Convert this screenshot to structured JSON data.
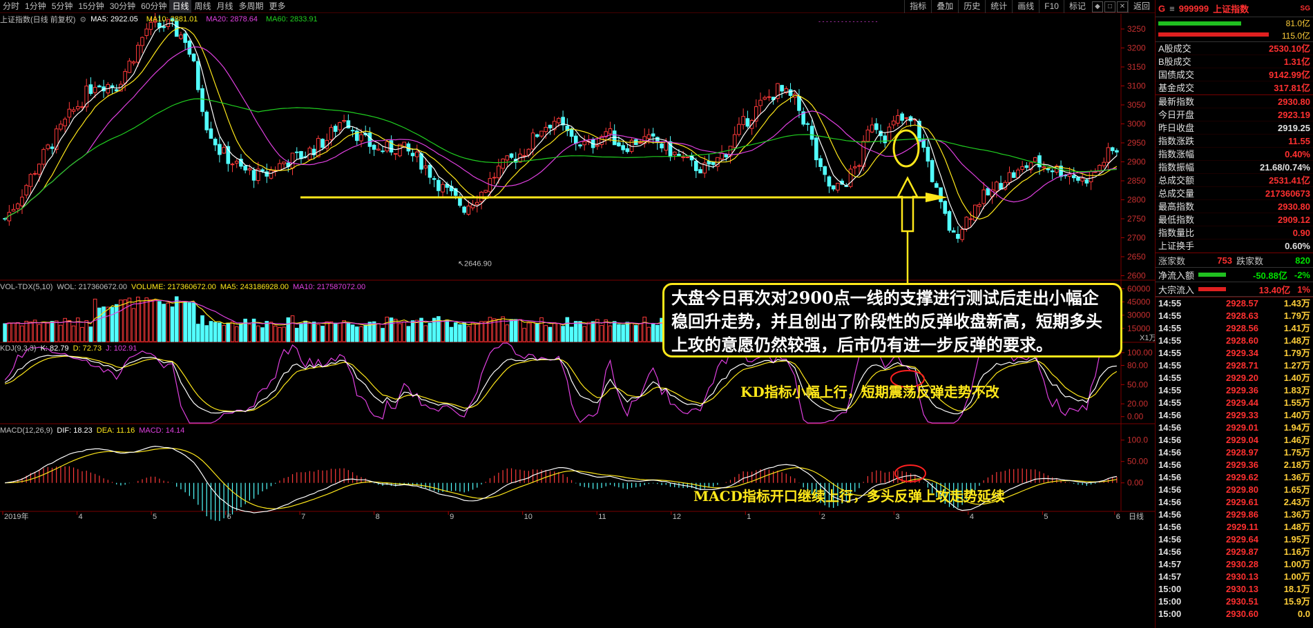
{
  "timeframes": [
    "分时",
    "1分钟",
    "5分钟",
    "15分钟",
    "30分钟",
    "60分钟",
    "日线",
    "周线",
    "月线",
    "多周期",
    "更多"
  ],
  "active_tf": "日线",
  "tools": [
    "指标",
    "叠加",
    "历史",
    "统计",
    "画线",
    "F10",
    "标记"
  ],
  "win_btns": [
    "◆",
    "□",
    "✕",
    "返回"
  ],
  "main_title": "上证指数(日线 前复权)",
  "ma_labels": [
    {
      "t": "MA5: 2922.05",
      "c": "#ffffff"
    },
    {
      "t": "MA10: 2881.01",
      "c": "#ffe81a"
    },
    {
      "t": "MA20: 2878.64",
      "c": "#e040e0"
    },
    {
      "t": "MA60: 2833.91",
      "c": "#20d020"
    }
  ],
  "vol_labels": [
    {
      "t": "VOL-TDX(5,10)",
      "c": "#c0c0c0"
    },
    {
      "t": "WOL: 217360672.00",
      "c": "#c0c0c0"
    },
    {
      "t": "VOLUME: 217360672.00",
      "c": "#ffe81a"
    },
    {
      "t": "MA5: 243186928.00",
      "c": "#ffe81a"
    },
    {
      "t": "MA10: 217587072.00",
      "c": "#e040e0"
    }
  ],
  "kdj_labels": [
    {
      "t": "KDJ(9,3,3)",
      "c": "#c0c0c0"
    },
    {
      "t": "K: 82.79",
      "c": "#ffffff"
    },
    {
      "t": "D: 72.73",
      "c": "#ffe81a"
    },
    {
      "t": "J: 102.91",
      "c": "#e040e0"
    }
  ],
  "macd_labels": [
    {
      "t": "MACD(12,26,9)",
      "c": "#c0c0c0"
    },
    {
      "t": "DIF: 18.23",
      "c": "#ffffff"
    },
    {
      "t": "DEA: 11.16",
      "c": "#ffe81a"
    },
    {
      "t": "MACD: 14.14",
      "c": "#e040e0"
    }
  ],
  "high_label": "3288.45",
  "low_label": "2646.90",
  "annotation": "大盘今日再次对2900点一线的支撑进行测试后走出小幅企稳回升走势，并且创出了阶段性的反弹收盘新高，短期多头上攻的意愿仍然较强，后市仍有进一步反弹的要求。",
  "kd_caption": "KD指标小幅上行，短期震荡反弹走势不改",
  "macd_caption": "MACD指标开口继续上行，多头反弹上攻走势延续",
  "price_axis": [
    "3250",
    "3200",
    "3150",
    "3100",
    "3050",
    "3000",
    "2950",
    "2900",
    "2850",
    "2800",
    "2750",
    "2700",
    "2650",
    "2600"
  ],
  "vol_axis": [
    "60000",
    "45000",
    "30000",
    "15000"
  ],
  "vol_unit": "X1万",
  "kdj_axis": [
    "100.00",
    "80.00",
    "50.00",
    "20.00",
    "0.00"
  ],
  "macd_axis": [
    "100.0",
    "50.00",
    "0.00"
  ],
  "months": [
    "2019年",
    "4",
    "5",
    "6",
    "7",
    "8",
    "9",
    "10",
    "11",
    "12",
    "1",
    "2",
    "3",
    "4",
    "5",
    "6"
  ],
  "period_label": "日线",
  "chart_data": {
    "type": "candlestick",
    "title": "上证指数(日线 前复权)",
    "price_range": [
      2590,
      3290
    ],
    "price_high": 3288.45,
    "price_low": 2646.9,
    "support_level": 2900,
    "price_path": [
      [
        0,
        2750
      ],
      [
        3,
        2800
      ],
      [
        8,
        2900
      ],
      [
        15,
        3020
      ],
      [
        21,
        3110
      ],
      [
        26,
        3100
      ],
      [
        30,
        3180
      ],
      [
        33,
        3250
      ],
      [
        38,
        3260
      ],
      [
        42,
        3225
      ],
      [
        44,
        3150
      ],
      [
        47,
        3000
      ],
      [
        50,
        2930
      ],
      [
        55,
        2880
      ],
      [
        60,
        2860
      ],
      [
        65,
        2900
      ],
      [
        70,
        2920
      ],
      [
        75,
        2960
      ],
      [
        79,
        3020
      ],
      [
        83,
        2960
      ],
      [
        87,
        2930
      ],
      [
        92,
        2940
      ],
      [
        97,
        2900
      ],
      [
        102,
        2830
      ],
      [
        107,
        2780
      ],
      [
        111,
        2820
      ],
      [
        115,
        2880
      ],
      [
        121,
        2930
      ],
      [
        125,
        2990
      ],
      [
        128,
        3010
      ],
      [
        132,
        2960
      ],
      [
        136,
        2940
      ],
      [
        140,
        2980
      ],
      [
        144,
        2940
      ],
      [
        148,
        2960
      ],
      [
        152,
        2950
      ],
      [
        156,
        2920
      ],
      [
        160,
        2890
      ],
      [
        164,
        2880
      ],
      [
        168,
        2930
      ],
      [
        172,
        3000
      ],
      [
        176,
        3050
      ],
      [
        180,
        3090
      ],
      [
        184,
        3060
      ],
      [
        187,
        2990
      ],
      [
        190,
        2870
      ],
      [
        193,
        2820
      ],
      [
        196,
        2850
      ],
      [
        199,
        2900
      ],
      [
        202,
        3010
      ],
      [
        205,
        2970
      ],
      [
        208,
        3010
      ],
      [
        212,
        3000
      ],
      [
        215,
        2900
      ],
      [
        218,
        2780
      ],
      [
        221,
        2700
      ],
      [
        224,
        2750
      ],
      [
        227,
        2800
      ],
      [
        230,
        2820
      ],
      [
        233,
        2860
      ],
      [
        236,
        2870
      ],
      [
        239,
        2900
      ],
      [
        242,
        2890
      ],
      [
        245,
        2880
      ],
      [
        248,
        2870
      ],
      [
        251,
        2850
      ],
      [
        254,
        2875
      ],
      [
        257,
        2920
      ],
      [
        259,
        2930.8
      ]
    ],
    "last_close": 2930.8,
    "MA5": 2922.05,
    "MA10": 2881.01,
    "MA20": 2878.64,
    "MA60": 2833.91,
    "volume": {
      "VOLUME": 217360672.0,
      "MA5": 243186928.0,
      "MA10": 217587072.0,
      "vol_range": [
        0,
        65000
      ]
    },
    "kdj": {
      "K": 82.79,
      "D": 72.73,
      "J": 102.91,
      "range": [
        -10,
        115
      ]
    },
    "macd": {
      "DIF": 18.23,
      "DEA": 11.16,
      "MACD": 14.14,
      "range": [
        -65,
        135
      ]
    },
    "x_ticks": [
      "2019年",
      "4",
      "5",
      "6",
      "7",
      "8",
      "9",
      "10",
      "11",
      "12",
      "1",
      "2",
      "3",
      "4",
      "5",
      "6"
    ]
  },
  "right": {
    "code": "999999",
    "name": "上证指数",
    "tag": "SG",
    "g": "G",
    "menu": "≡",
    "bar1": "81.0亿",
    "bar2": "115.0亿",
    "stats1": [
      [
        "A股成交",
        "2530.10亿",
        "red"
      ],
      [
        "B股成交",
        "1.31亿",
        "red"
      ],
      [
        "国债成交",
        "9142.99亿",
        "red"
      ],
      [
        "基金成交",
        "317.81亿",
        "red"
      ]
    ],
    "stats2": [
      [
        "最新指数",
        "2930.80",
        "red"
      ],
      [
        "今日开盘",
        "2923.19",
        "red"
      ],
      [
        "昨日收盘",
        "2919.25",
        "white"
      ],
      [
        "指数涨跌",
        "11.55",
        "red"
      ],
      [
        "指数涨幅",
        "0.40%",
        "red"
      ],
      [
        "指数振幅",
        "21.68/0.74%",
        "white"
      ],
      [
        "总成交额",
        "2531.41亿",
        "red"
      ],
      [
        "总成交量",
        "217360673",
        "red"
      ],
      [
        "最高指数",
        "2930.80",
        "red"
      ],
      [
        "最低指数",
        "2909.12",
        "red"
      ],
      [
        "指数量比",
        "0.90",
        "red"
      ],
      [
        "上证换手",
        "0.60%",
        "white"
      ]
    ],
    "up_label": "涨家数",
    "up": "753",
    "down_label": "跌家数",
    "down": "820",
    "flow": [
      [
        "净流入额",
        "-50.88亿",
        "-2%",
        "green"
      ],
      [
        "大宗流入",
        "13.40亿",
        "1%",
        "red"
      ]
    ],
    "ticks": [
      [
        "14:55",
        "2928.57",
        "1.43万"
      ],
      [
        "14:55",
        "2928.63",
        "1.79万"
      ],
      [
        "14:55",
        "2928.56",
        "1.41万"
      ],
      [
        "14:55",
        "2928.60",
        "1.48万"
      ],
      [
        "14:55",
        "2929.34",
        "1.79万"
      ],
      [
        "14:55",
        "2928.71",
        "1.27万"
      ],
      [
        "14:55",
        "2929.20",
        "1.40万"
      ],
      [
        "14:55",
        "2929.36",
        "1.83万"
      ],
      [
        "14:55",
        "2929.44",
        "1.55万"
      ],
      [
        "14:56",
        "2929.33",
        "1.40万"
      ],
      [
        "14:56",
        "2929.01",
        "1.94万"
      ],
      [
        "14:56",
        "2929.04",
        "1.46万"
      ],
      [
        "14:56",
        "2928.97",
        "1.75万"
      ],
      [
        "14:56",
        "2929.36",
        "2.18万"
      ],
      [
        "14:56",
        "2929.62",
        "1.36万"
      ],
      [
        "14:56",
        "2929.80",
        "1.65万"
      ],
      [
        "14:56",
        "2929.61",
        "2.43万"
      ],
      [
        "14:56",
        "2929.86",
        "1.36万"
      ],
      [
        "14:56",
        "2929.11",
        "1.48万"
      ],
      [
        "14:56",
        "2929.64",
        "1.95万"
      ],
      [
        "14:56",
        "2929.87",
        "1.16万"
      ],
      [
        "14:57",
        "2930.28",
        "1.00万"
      ],
      [
        "14:57",
        "2930.13",
        "1.00万"
      ],
      [
        "15:00",
        "2930.13",
        "18.1万"
      ],
      [
        "15:00",
        "2930.51",
        "15.9万"
      ],
      [
        "15:00",
        "2930.60",
        "0.0"
      ]
    ]
  }
}
